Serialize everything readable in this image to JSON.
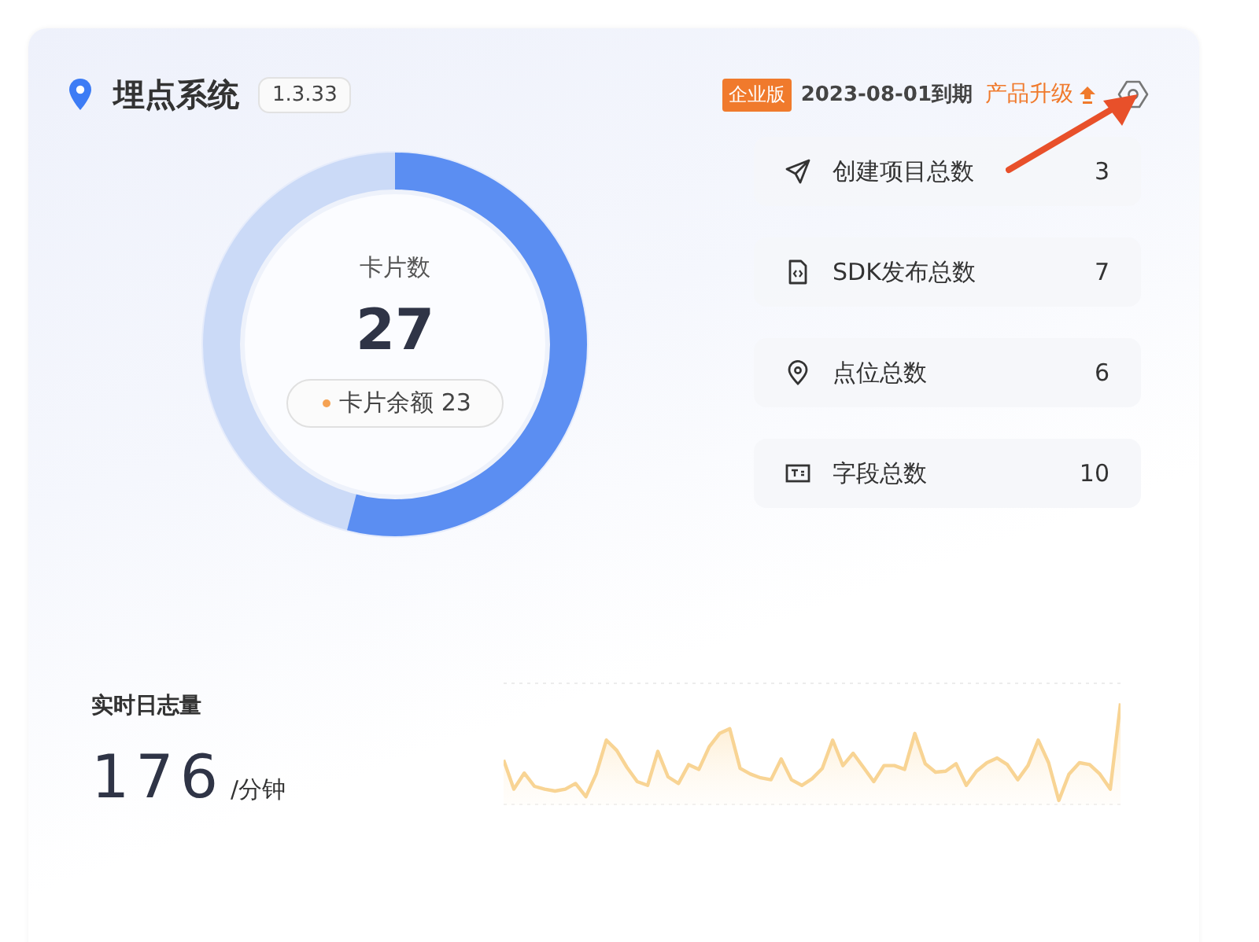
{
  "header": {
    "title": "埋点系统",
    "version": "1.3.33",
    "edition_badge": "企业版",
    "expiry": "2023-08-01到期",
    "upgrade_link": "产品升级"
  },
  "card_count": {
    "label": "卡片数",
    "value": "27",
    "level": 0.54,
    "balance": "卡片余额 23"
  },
  "stats": [
    {
      "kind": "send",
      "label": "创建项目总数",
      "value": "3"
    },
    {
      "kind": "code-file",
      "label": "SDK发布总数",
      "value": "7"
    },
    {
      "kind": "pin",
      "label": "点位总数",
      "value": "6"
    },
    {
      "kind": "text-field",
      "label": "字段总数",
      "value": "10"
    }
  ],
  "log_volume": {
    "title": "实时日志量",
    "value": "176",
    "unit": "/分钟"
  }
}
